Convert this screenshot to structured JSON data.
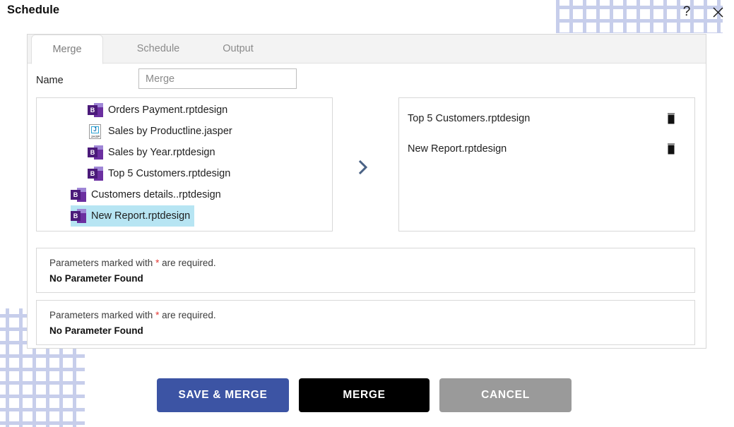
{
  "header": {
    "title": "Schedule",
    "help_icon": "question-mark-icon",
    "close_icon": "close-icon"
  },
  "tabs": [
    {
      "id": "merge",
      "label": "Merge",
      "active": true
    },
    {
      "id": "schedule",
      "label": "Schedule",
      "active": false
    },
    {
      "id": "output",
      "label": "Output",
      "active": false
    }
  ],
  "form": {
    "name_label": "Name",
    "name_value": "Merge",
    "name_placeholder": "Merge"
  },
  "source_panel": {
    "items": [
      {
        "label": "Orders Payment.rptdesign",
        "icon": "birt-report-icon",
        "indent": "deep",
        "selected": false
      },
      {
        "label": "Sales by Productline.jasper",
        "icon": "jasper-report-icon",
        "indent": "deep",
        "selected": false
      },
      {
        "label": "Sales by Year.rptdesign",
        "icon": "birt-report-icon",
        "indent": "deep",
        "selected": false
      },
      {
        "label": "Top 5 Customers.rptdesign",
        "icon": "birt-report-icon",
        "indent": "deep",
        "selected": false
      },
      {
        "label": "Customers details..rptdesign",
        "icon": "birt-report-icon",
        "indent": "shallow",
        "selected": false
      },
      {
        "label": "New Report.rptdesign",
        "icon": "birt-report-icon",
        "indent": "shallow",
        "selected": true
      }
    ]
  },
  "move_button": {
    "icon": "chevron-right-icon"
  },
  "target_panel": {
    "items": [
      {
        "label": "Top 5 Customers.rptdesign",
        "delete_icon": "trash-icon"
      },
      {
        "label": "New Report.rptdesign",
        "delete_icon": "trash-icon"
      }
    ]
  },
  "parameter_sections": [
    {
      "hint_prefix": "Parameters marked with ",
      "hint_star": "*",
      "hint_suffix": " are required.",
      "result": "No Parameter Found"
    },
    {
      "hint_prefix": "Parameters marked with ",
      "hint_star": "*",
      "hint_suffix": " are required.",
      "result": "No Parameter Found"
    }
  ],
  "footer": {
    "save_merge_label": "SAVE & MERGE",
    "merge_label": "MERGE",
    "cancel_label": "CANCEL"
  },
  "colors": {
    "primary_blue": "#3c54a4",
    "merge_black": "#000000",
    "cancel_gray": "#9a9a9a",
    "selection_cyan": "#b7e5f3",
    "required_star_red": "#e53935",
    "pattern_dot": "#a6b1e0",
    "arrow_slate": "#4a6285"
  }
}
